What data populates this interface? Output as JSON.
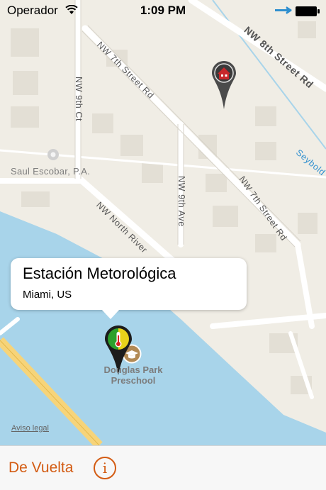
{
  "status_bar": {
    "carrier": "Operador",
    "time": "1:09 PM",
    "wifi_icon": "wifi-icon",
    "battery_icon": "battery-icon"
  },
  "map": {
    "labels": {
      "poi": "Saul Escobar, P.A.",
      "street_nw8th": "NW 8th Street Rd",
      "street_nw7th_top": "NW 7th Street Rd",
      "street_nw7th_right": "NW 7th Street Rd",
      "street_nw9thct": "NW 9th Ct",
      "street_nw9thave": "NW 9th Ave",
      "street_nwnorthriver": "NW North River",
      "water": "Seybold",
      "school": "Douglas Park Preschool"
    },
    "pins": [
      {
        "name": "home-pin",
        "icon": "house-icon",
        "color": "#4b4b4b",
        "accent": "#c8272b"
      },
      {
        "name": "weather-station-pin",
        "icon": "thermometer-icon",
        "colors": [
          "#2ca02c",
          "#e8d21a"
        ]
      }
    ],
    "colors": {
      "land": "#f0ede5",
      "water": "#a8d4ea",
      "road": "#ffffff",
      "highway": "#f6d47a"
    }
  },
  "callout": {
    "title": "Estación Metorológica",
    "subtitle": "Miami, US"
  },
  "legal": "Aviso legal",
  "toolbar": {
    "back_label": "De Vuelta",
    "info_label": "i",
    "accent": "#d35b12"
  }
}
